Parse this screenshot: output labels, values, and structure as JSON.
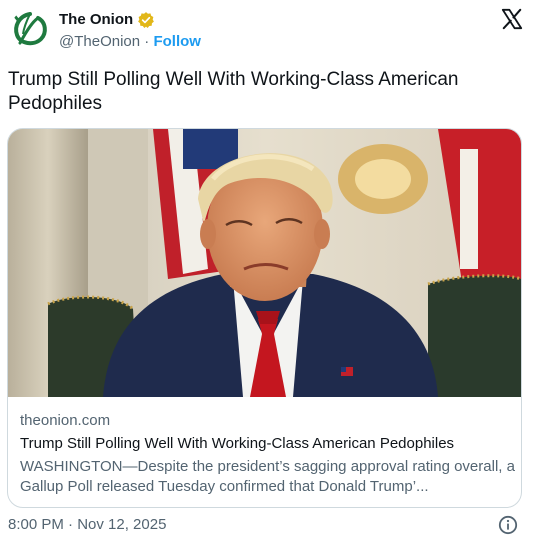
{
  "author": {
    "display_name": "The Onion",
    "handle": "@TheOnion",
    "separator": " · ",
    "follow_label": "Follow"
  },
  "icons": {
    "avatar": "onion-logo-icon",
    "verified": "verified-badge-icon",
    "platform": "x-logo-icon",
    "info": "info-icon"
  },
  "colors": {
    "accent": "#1d9bf0",
    "verified_gold": "#e2b719",
    "onion_green": "#1f7a3f",
    "text_primary": "#0f1419",
    "text_secondary": "#536471"
  },
  "tweet": {
    "text": "Trump Still Polling Well With Working-Class American Pedophiles"
  },
  "card": {
    "domain": "theonion.com",
    "title": "Trump Still Polling Well With Working-Class American Pedophiles",
    "description": "WASHINGTON—Despite the president’s sagging approval rating overall, a Gallup Poll released Tuesday confirmed that Donald Trump’..."
  },
  "footer": {
    "timestamp": "8:00 PM · Nov 12, 2025"
  }
}
